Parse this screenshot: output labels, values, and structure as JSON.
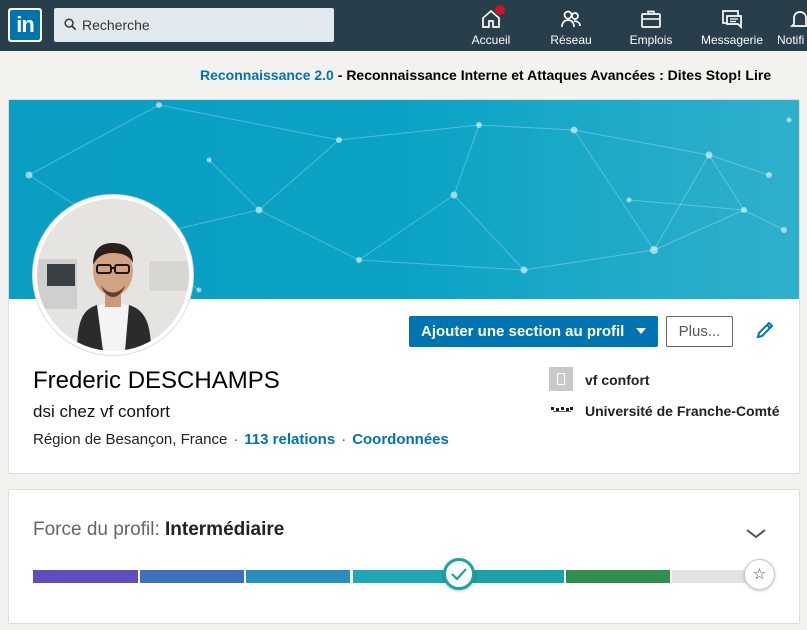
{
  "topnav": {
    "logo_text": "in",
    "search_placeholder": "Recherche",
    "items": [
      {
        "label": "Accueil",
        "icon": "home-icon",
        "has_badge": true
      },
      {
        "label": "Réseau",
        "icon": "network-icon"
      },
      {
        "label": "Emplois",
        "icon": "briefcase-icon"
      },
      {
        "label": "Messagerie",
        "icon": "messaging-icon"
      },
      {
        "label": "Notifi",
        "icon": "bell-icon"
      }
    ]
  },
  "ad": {
    "link_text": "Reconnaissance 2.0",
    "separator": " - ",
    "text": "Reconnaissance Interne et Attaques Avancées : Dites Stop! Lire"
  },
  "profile": {
    "name": "Frederic DESCHAMPS",
    "headline": "dsi chez vf confort",
    "location": "Région de Besançon, France",
    "dot": "·",
    "connections": "113 relations",
    "contact": "Coordonnées",
    "add_section_label": "Ajouter une section au profil",
    "more_label": "Plus...",
    "company": "vf confort",
    "school": "Université de Franche-Comté"
  },
  "strength": {
    "label": "Force du profil: ",
    "level": "Intermédiaire",
    "star": "☆"
  },
  "colors": {
    "nav_bg": "#283e4a",
    "brand_blue": "#0073b1",
    "banner": "#0ba3c5",
    "meter_segments": [
      "#5d4fbf",
      "#3d70bd",
      "#2a8dbf",
      "#1fa7b4",
      "#1aa3a6",
      "#1f9d74",
      "#2e8f4f",
      "#e1e4e7"
    ]
  }
}
